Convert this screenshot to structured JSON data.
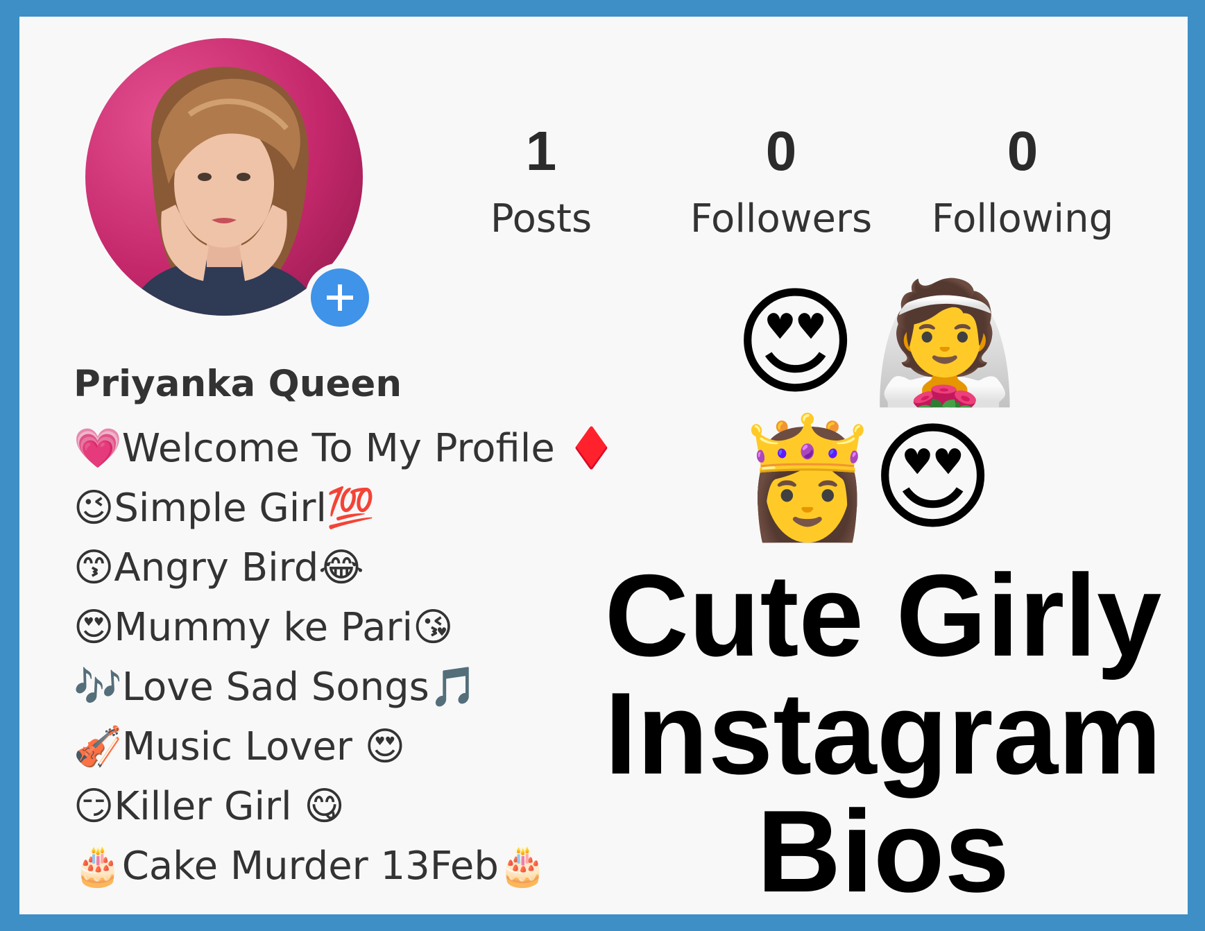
{
  "profile": {
    "name": "Priyanka Queen",
    "add_button_icon": "plus-icon"
  },
  "stats": [
    {
      "value": "1",
      "label": "Posts"
    },
    {
      "value": "0",
      "label": "Followers"
    },
    {
      "value": "0",
      "label": "Following"
    }
  ],
  "bio": [
    "💗Welcome To My Profile ♦️",
    "😉Simple Girl💯",
    "😙Angry Bird😂",
    "😍Mummy ke Pari😘",
    "🎶Love Sad Songs🎵",
    "🎻Music Lover 😍",
    "😏Killer Girl 😋",
    "🎂Cake Murder 13Feb🎂"
  ],
  "decor_emoji": [
    "😍",
    "👰",
    "👸",
    "😍"
  ],
  "title": [
    "Cute Girly",
    "Instagram",
    "Bios"
  ],
  "colors": {
    "border": "#3d8fc6",
    "add_button": "#3f93e8",
    "avatar_background": "#d33a7a"
  }
}
